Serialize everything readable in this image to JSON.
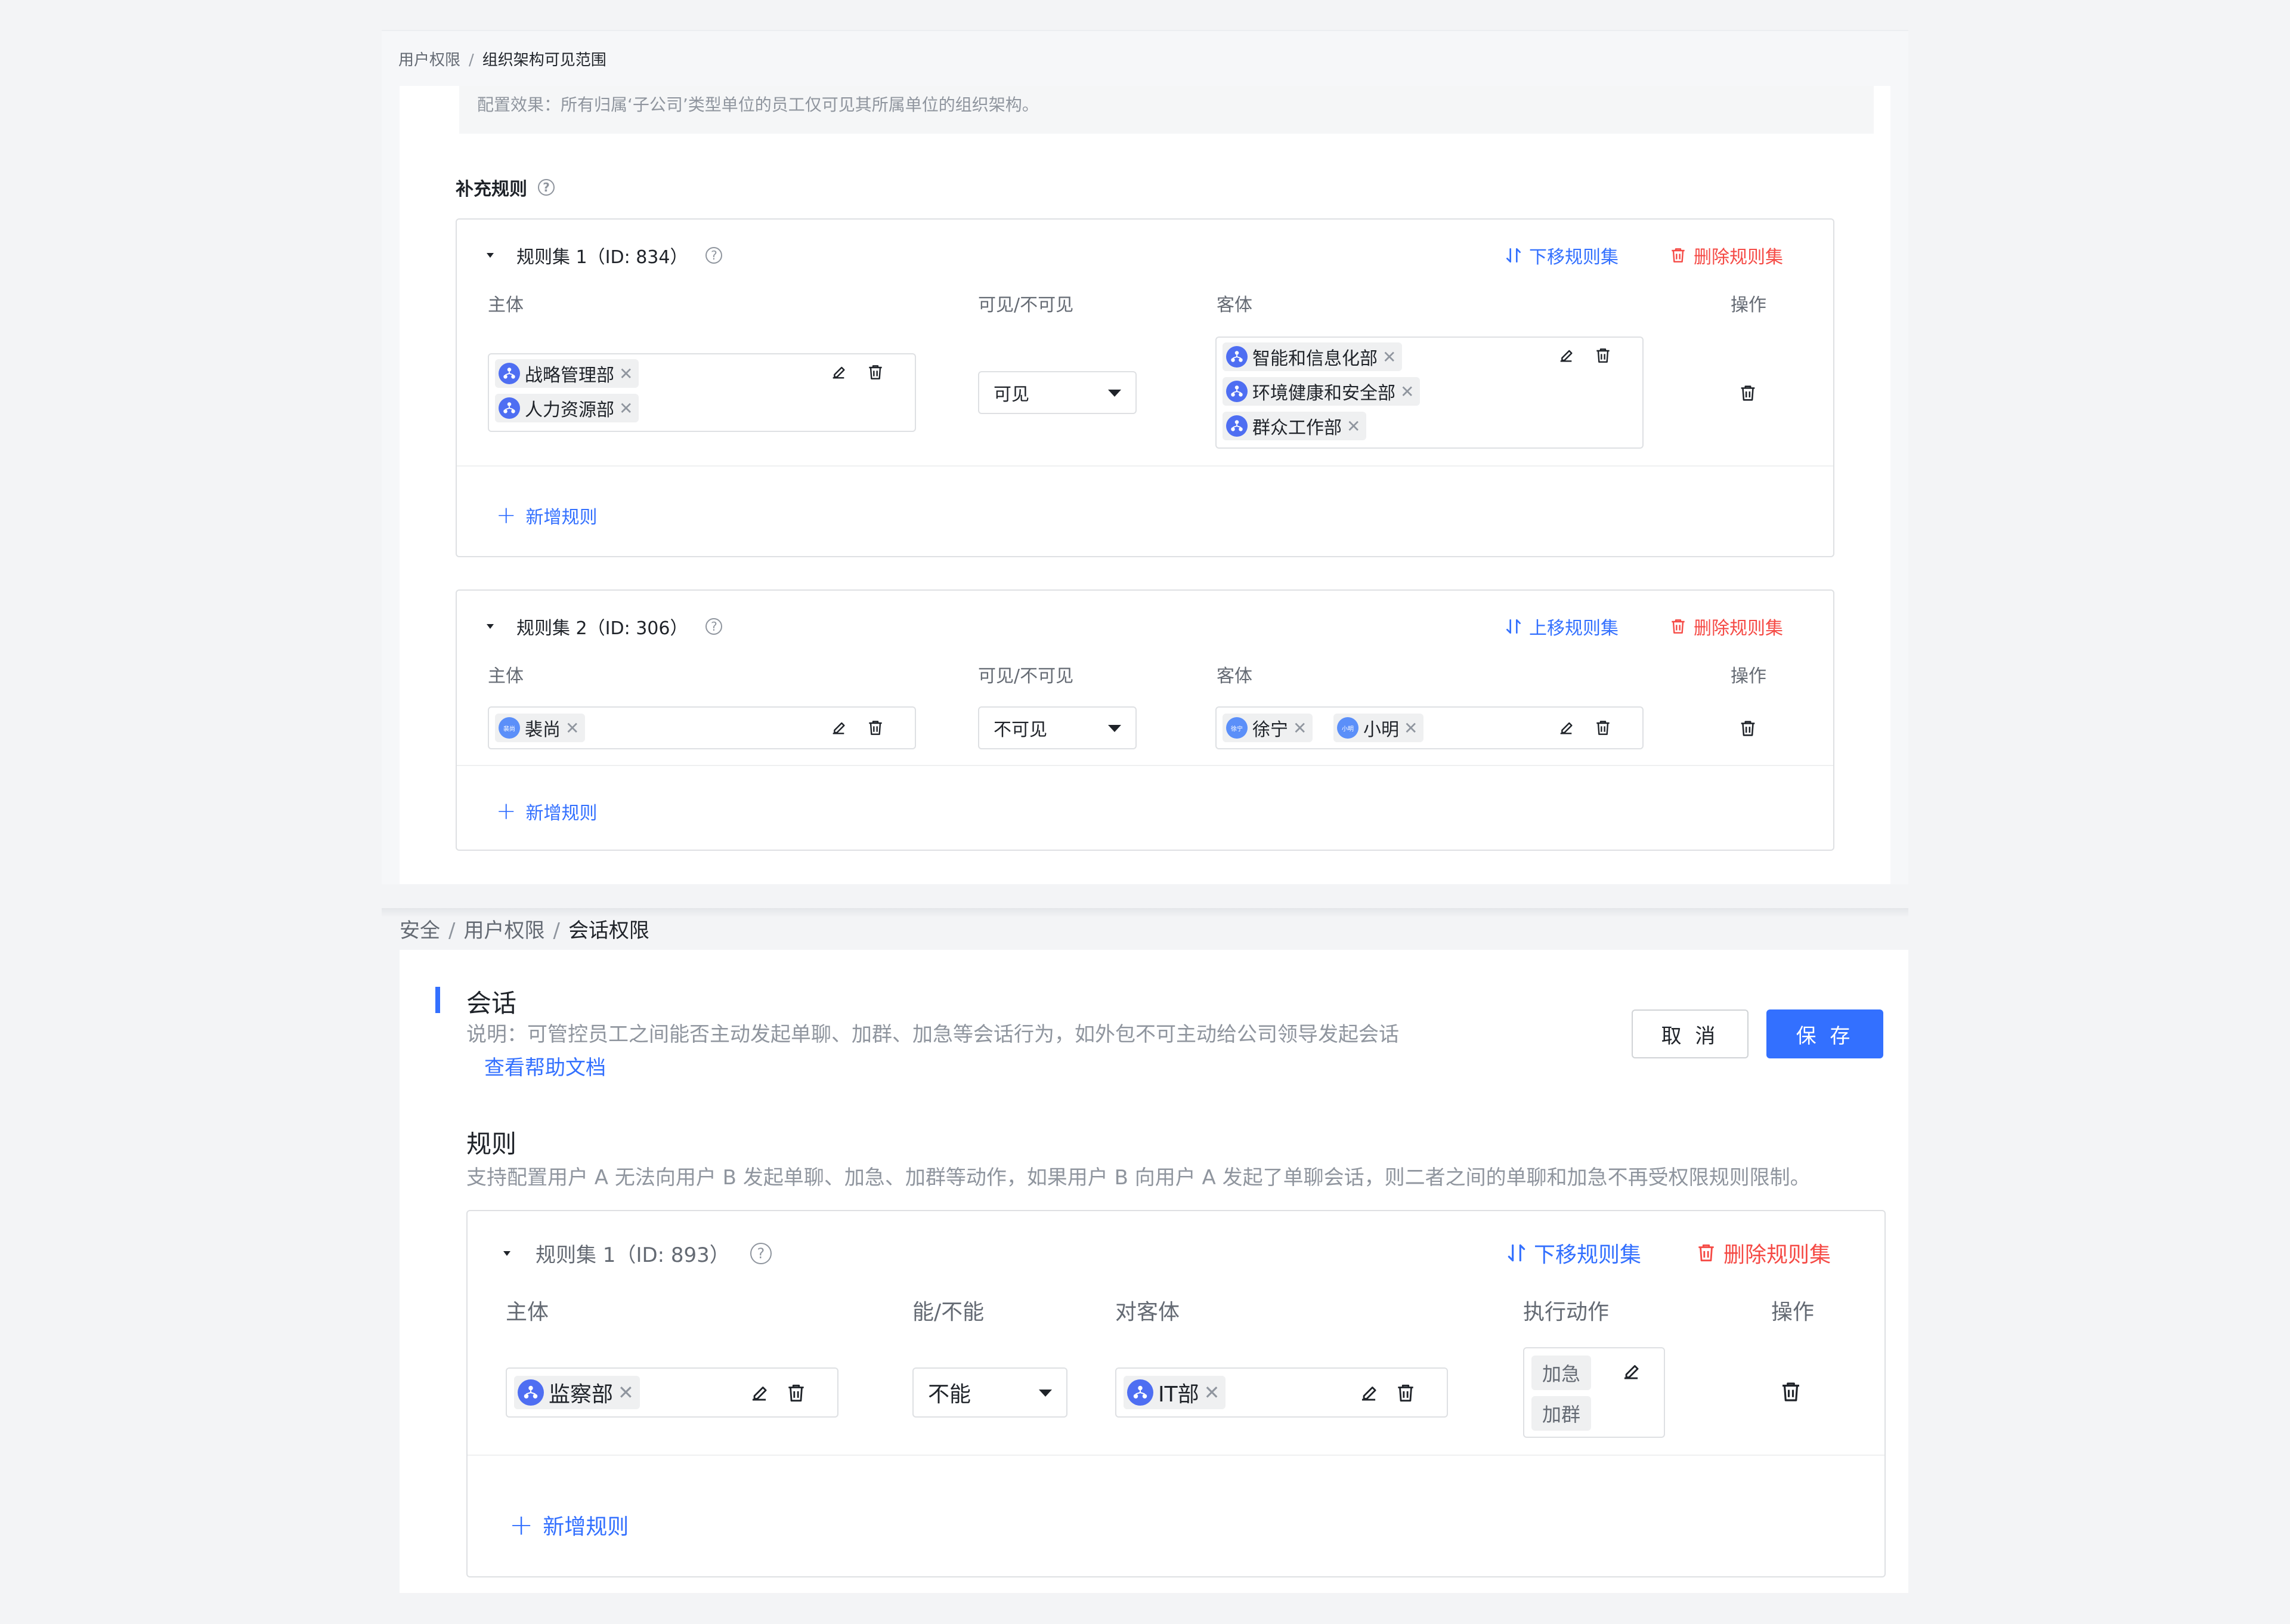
{
  "top": {
    "breadcrumb": {
      "parent": "用户权限",
      "separator": "/",
      "current": "组织架构可见范围"
    },
    "effect_note": "配置效果：所有归属‘子公司’类型单位的员工仅可见其所属单位的组织架构。",
    "section_title": "补充规则",
    "columns": {
      "subject": "主体",
      "visibility": "可见/不可见",
      "object": "客体",
      "ops": "操作"
    },
    "rulesets": [
      {
        "title": "规则集 1（ID: 834）",
        "move_label": "下移规则集",
        "delete_label": "删除规则集",
        "subjects": [
          "战略管理部",
          "人力资源部"
        ],
        "visibility": "可见",
        "objects": [
          "智能和信息化部",
          "环境健康和安全部",
          "群众工作部"
        ],
        "add_rule": "新增规则"
      },
      {
        "title": "规则集 2（ID: 306）",
        "move_label": "上移规则集",
        "delete_label": "删除规则集",
        "subjects": [
          "裴尚"
        ],
        "subject_avatars": [
          "裴尚"
        ],
        "visibility": "不可见",
        "objects": [
          "徐宁",
          "小明"
        ],
        "object_avatars": [
          "徐宁",
          "小明"
        ],
        "add_rule": "新增规则"
      }
    ]
  },
  "bottom": {
    "breadcrumb": {
      "root": "安全",
      "parent": "用户权限",
      "separator": "/",
      "current": "会话权限"
    },
    "title": "会话",
    "description": "说明：可管控员工之间能否主动发起单聊、加群、加急等会话行为，如外包不可主动给公司领导发起会话",
    "help_link": "查看帮助文档",
    "cancel": "取 消",
    "save": "保 存",
    "rules_title": "规则",
    "rules_desc": "支持配置用户 A 无法向用户 B 发起单聊、加急、加群等动作，如果用户 B 向用户 A 发起了单聊会话，则二者之间的单聊和加急不再受权限规则限制。",
    "columns": {
      "subject": "主体",
      "can": "能/不能",
      "object": "对客体",
      "action": "执行动作",
      "ops": "操作"
    },
    "ruleset": {
      "title": "规则集 1（ID: 893）",
      "move_label": "下移规则集",
      "delete_label": "删除规则集",
      "subject": "监察部",
      "can": "不能",
      "object": "IT部",
      "actions": [
        "加急",
        "加群"
      ],
      "add_rule": "新增规则"
    }
  },
  "colors": {
    "accent": "#3370ff",
    "danger": "#f54a45",
    "org_icon": "#4e6ef2"
  }
}
